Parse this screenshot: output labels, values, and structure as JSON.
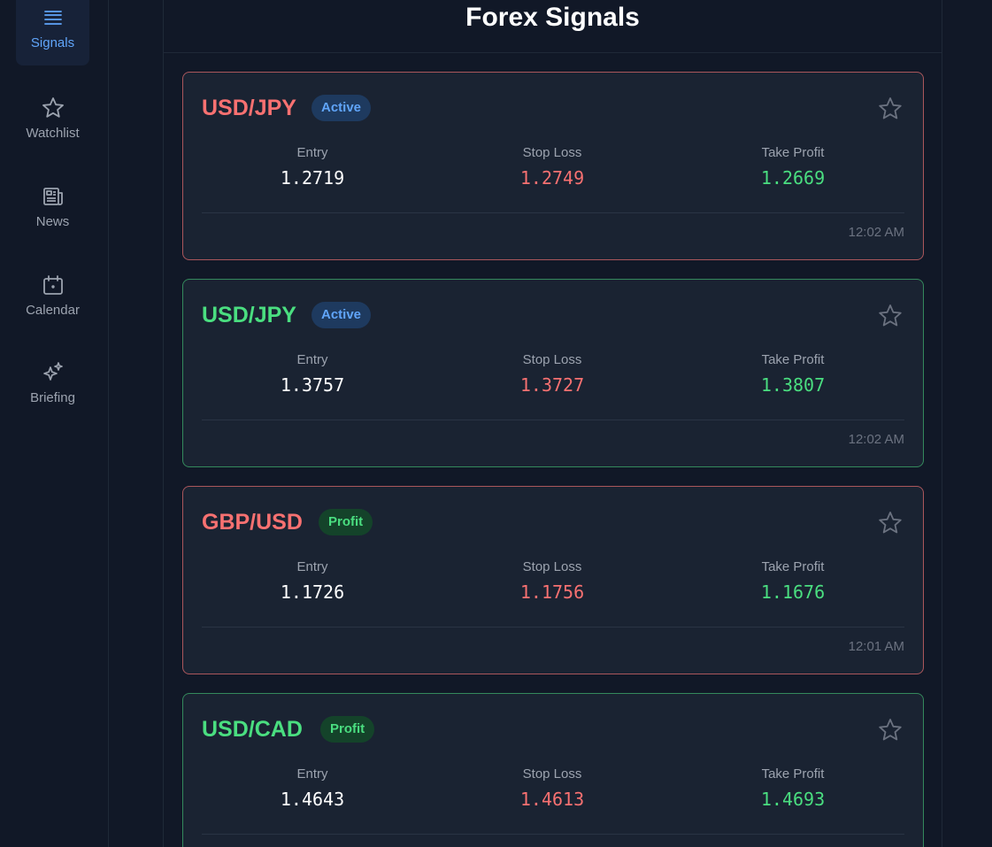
{
  "sidebar": {
    "items": [
      {
        "label": "Signals",
        "icon": "list-icon",
        "active": true
      },
      {
        "label": "Watchlist",
        "icon": "star-icon",
        "active": false
      },
      {
        "label": "News",
        "icon": "newspaper-icon",
        "active": false
      },
      {
        "label": "Calendar",
        "icon": "calendar-icon",
        "active": false
      },
      {
        "label": "Briefing",
        "icon": "sparkles-icon",
        "active": false
      }
    ]
  },
  "header": {
    "title": "Forex Signals"
  },
  "columns": {
    "entry": "Entry",
    "stop_loss": "Stop Loss",
    "take_profit": "Take Profit"
  },
  "signals": [
    {
      "pair": "USD/JPY",
      "direction": "sell",
      "status": "Active",
      "entry": "1.2719",
      "stop_loss": "1.2749",
      "take_profit": "1.2669",
      "time": "12:02 AM"
    },
    {
      "pair": "USD/JPY",
      "direction": "buy",
      "status": "Active",
      "entry": "1.3757",
      "stop_loss": "1.3727",
      "take_profit": "1.3807",
      "time": "12:02 AM"
    },
    {
      "pair": "GBP/USD",
      "direction": "sell",
      "status": "Profit",
      "entry": "1.1726",
      "stop_loss": "1.1756",
      "take_profit": "1.1676",
      "time": "12:01 AM"
    },
    {
      "pair": "USD/CAD",
      "direction": "buy",
      "status": "Profit",
      "entry": "1.4643",
      "stop_loss": "1.4613",
      "take_profit": "1.4693",
      "time": ""
    }
  ],
  "colors": {
    "background": "#111827",
    "card": "#1a2332",
    "sell": "#f87171",
    "buy": "#4ade80",
    "accent": "#60a5fa"
  }
}
